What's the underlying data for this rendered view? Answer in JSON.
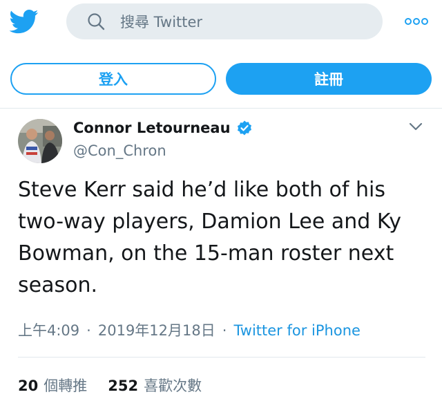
{
  "header": {
    "search_placeholder": "搜尋 Twitter"
  },
  "auth": {
    "login_label": "登入",
    "signup_label": "註冊"
  },
  "tweet": {
    "author_name": "Connor Letourneau",
    "author_handle": "@Con_Chron",
    "text": "Steve Kerr said he’d like both of his two-way players, Damion Lee and Ky Bowman, on the 15-man roster next season.",
    "time": "上午4:09",
    "date": "2019年12月18日",
    "source": "Twitter for iPhone",
    "retweets_count": "20",
    "retweets_label": "個轉推",
    "likes_count": "252",
    "likes_label": "喜歡次數"
  },
  "icons": {
    "logo": "twitter-bird-icon",
    "search": "search-icon",
    "more": "more-icon",
    "verified": "verified-icon",
    "caret": "chevron-down-icon"
  },
  "colors": {
    "brand": "#1da1f2",
    "link": "#1b95e0",
    "search_bg": "#e6ecf0",
    "muted": "#657786"
  }
}
